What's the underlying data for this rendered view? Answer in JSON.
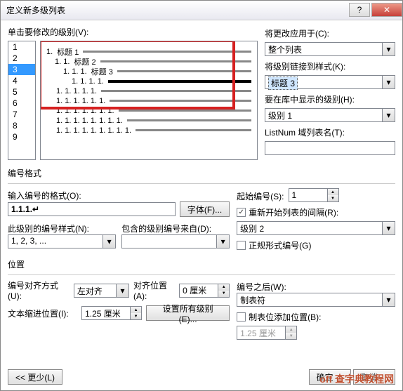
{
  "title": "定义新多级列表",
  "level_label": "单击要修改的级别(V):",
  "levels": [
    "1",
    "2",
    "3",
    "4",
    "5",
    "6",
    "7",
    "8",
    "9"
  ],
  "selected_level": "3",
  "preview": [
    {
      "num": "1.",
      "label": "标题 1"
    },
    {
      "num": "1. 1.",
      "label": "标题 2"
    },
    {
      "num": "1. 1. 1.",
      "label": "标题 3"
    },
    {
      "num": "1. 1. 1. 1.",
      "label": ""
    },
    {
      "num": "1. 1. 1. 1. 1.",
      "label": ""
    },
    {
      "num": "1. 1. 1. 1. 1. 1.",
      "label": ""
    },
    {
      "num": "1. 1. 1. 1. 1. 1. 1.",
      "label": ""
    },
    {
      "num": "1. 1. 1. 1. 1. 1. 1. 1.",
      "label": ""
    },
    {
      "num": "1. 1. 1. 1. 1. 1. 1. 1. 1.",
      "label": ""
    }
  ],
  "apply_to_label": "将更改应用于(C):",
  "apply_to_value": "整个列表",
  "link_style_label": "将级别链接到样式(K):",
  "link_style_value": "标题 3",
  "gallery_label": "要在库中显示的级别(H):",
  "gallery_value": "级别 1",
  "listnum_label": "ListNum 域列表名(T):",
  "listnum_value": "",
  "number_format_title": "编号格式",
  "enter_format_label": "输入编号的格式(O):",
  "enter_format_value": "1.1.1.↵",
  "font_btn": "字体(F)...",
  "number_style_label": "此级别的编号样式(N):",
  "number_style_value": "1, 2, 3, ...",
  "include_from_label": "包含的级别编号来自(D):",
  "include_from_value": "",
  "start_at_label": "起始编号(S):",
  "start_at_value": "1",
  "restart_label": "重新开始列表的间隔(R):",
  "restart_checked": "✓",
  "restart_value": "级别 2",
  "legal_label": "正规形式编号(G)",
  "position_title": "位置",
  "align_label": "编号对齐方式(U):",
  "align_value": "左对齐",
  "align_at_label": "对齐位置(A):",
  "align_at_value": "0 厘米",
  "indent_label": "文本缩进位置(I):",
  "indent_value": "1.25 厘米",
  "set_all_btn": "设置所有级别(E)...",
  "follow_label": "编号之后(W):",
  "follow_value": "制表符",
  "tabstop_label": "制表位添加位置(B):",
  "tabstop_value": "1.25 厘米",
  "less_btn": "<< 更少(L)",
  "ok_btn": "确定",
  "cancel_btn": "取消",
  "watermark": "off 查字典教程网"
}
